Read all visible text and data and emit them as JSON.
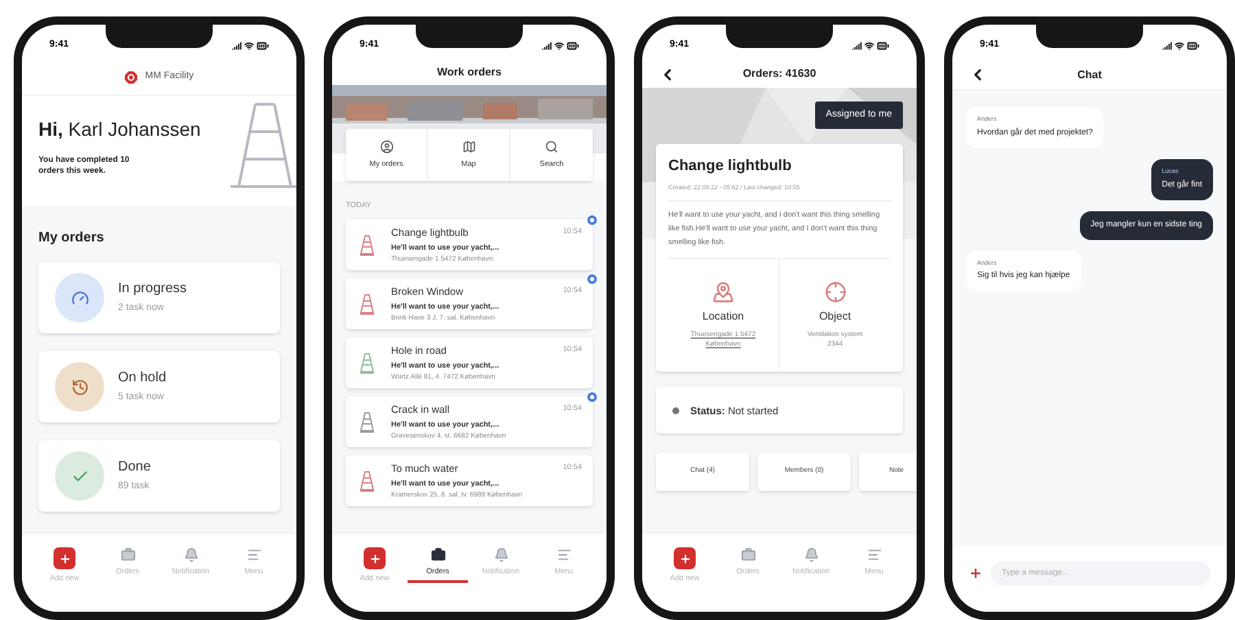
{
  "home": {
    "time": "9:41",
    "brand": "MM Facility",
    "greeting": "**Hi,** Karl Johanssen",
    "summary": "You have completed 10 orders this week.",
    "section_title": "My orders",
    "cards": [
      {
        "kind": "progress",
        "title": "In progress",
        "subtitle": "2 task now",
        "color": "#dce6fa"
      },
      {
        "kind": "hold",
        "title": "On hold",
        "subtitle": "5 task now",
        "color": "#eedfcb"
      },
      {
        "kind": "done",
        "title": "Done",
        "subtitle": "89 task",
        "color": "#dcebdf"
      }
    ],
    "tabbar": [
      {
        "kind": "add",
        "label": "Add new",
        "selected": false
      },
      {
        "kind": "orders",
        "label": "Orders",
        "selected": false
      },
      {
        "kind": "bell",
        "label": "Notification",
        "selected": false
      },
      {
        "kind": "menu",
        "label": "Menu",
        "selected": false
      }
    ]
  },
  "work_orders": {
    "time": "9:41",
    "title": "Work orders",
    "actions": [
      {
        "kind": "person",
        "label": "My orders"
      },
      {
        "kind": "map",
        "label": "Map"
      },
      {
        "kind": "search",
        "label": "Search"
      }
    ],
    "section": "TODAY",
    "orders": [
      {
        "title": "Change lightbulb",
        "snippet": "He'll want to use your yacht,...",
        "address": "Thuesengade 1 5472 København",
        "time": "10:54",
        "color": "#d98080",
        "unread": true
      },
      {
        "title": "Broken Window",
        "snippet": "He'll want to use your yacht,...",
        "address": "Brink Have 3 J, 7. sal. København",
        "time": "10:54",
        "color": "#d98080",
        "unread": true
      },
      {
        "title": "Hole in road",
        "snippet": "He'll want to use your yacht,...",
        "address": "Würtz Allé 81, 4. 7472 København",
        "time": "10:54",
        "color": "#8fbf9f",
        "unread": false
      },
      {
        "title": "Crack in wall",
        "snippet": "He'll want to use your yacht,...",
        "address": "Gravesenskov 4, st. 6682 København",
        "time": "10:54",
        "color": "#9a9aa2",
        "unread": true
      },
      {
        "title": "To much water",
        "snippet": "He'll want to use your yacht,...",
        "address": "Kramerskov 25, 8. sal. tv. 6989 København",
        "time": "10:54",
        "color": "#d98080",
        "unread": false
      }
    ],
    "tabbar": [
      {
        "kind": "add",
        "label": "Add new",
        "selected": false
      },
      {
        "kind": "orders",
        "label": "Orders",
        "selected": true
      },
      {
        "kind": "bell",
        "label": "Notification",
        "selected": false
      },
      {
        "kind": "menu",
        "label": "Menu",
        "selected": false
      }
    ]
  },
  "order_detail": {
    "time": "9:41",
    "title": "Orders: 41630",
    "assign_button": "Assigned to me",
    "heading": "Change lightbulb",
    "meta": "Created: 22.08.22 - 05:62 / Last changed: 10:05",
    "description": "He'll want to use your yacht, and I don't want this thing smelling like fish.He'll want to use your yacht, and I don't want this thing smelling like fish.",
    "info": [
      {
        "kind": "location",
        "label": "Location",
        "value": "Thuesengade 1 5472 København"
      },
      {
        "kind": "object",
        "label": "Object",
        "value": "Ventilation system 2344"
      }
    ],
    "status": "**Status:** Not started",
    "tabs": [
      "Chat (4)",
      "Members (0)",
      "Note"
    ],
    "tabbar": [
      {
        "kind": "add",
        "label": "Add new",
        "selected": false
      },
      {
        "kind": "orders",
        "label": "Orders",
        "selected": false
      },
      {
        "kind": "bell",
        "label": "Notification",
        "selected": false
      },
      {
        "kind": "menu",
        "label": "Menu",
        "selected": false
      }
    ]
  },
  "chat": {
    "time": "9:41",
    "title": "Chat",
    "messages": [
      {
        "sender": "Anders",
        "text": "Hvordan går det med projektet?",
        "mine": false
      },
      {
        "sender": "Lucas",
        "text": "Det går fint",
        "mine": true
      },
      {
        "text": "Jeg mangler kun en sidste ting",
        "mine": true
      },
      {
        "sender": "Anders",
        "text": "Sig til hvis jeg kan hjælpe",
        "mine": false
      }
    ],
    "input": {
      "placeholder": "Type a message..."
    }
  }
}
